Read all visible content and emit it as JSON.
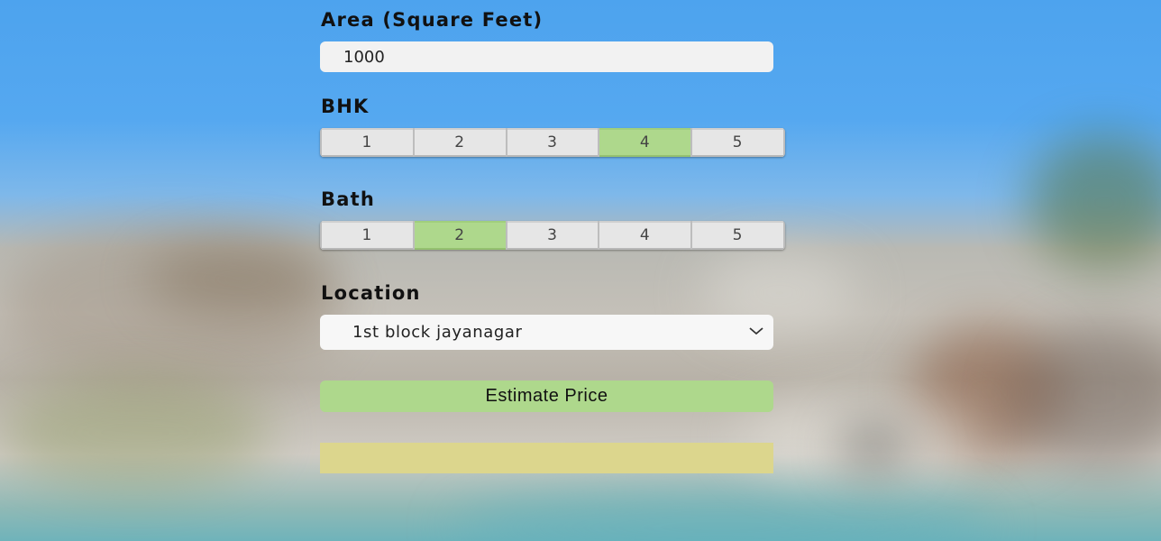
{
  "form": {
    "area": {
      "label": "Area (Square Feet)",
      "value": "1000"
    },
    "bhk": {
      "label": "BHK",
      "options": [
        "1",
        "2",
        "3",
        "4",
        "5"
      ],
      "selected": "4"
    },
    "bath": {
      "label": "Bath",
      "options": [
        "1",
        "2",
        "3",
        "4",
        "5"
      ],
      "selected": "2"
    },
    "location": {
      "label": "Location",
      "selected": "1st block jayanagar"
    },
    "submit_label": "Estimate Price",
    "result": ""
  },
  "colors": {
    "selected": "#aed88c",
    "button": "#aed88c",
    "result_box": "#dcd68d"
  }
}
